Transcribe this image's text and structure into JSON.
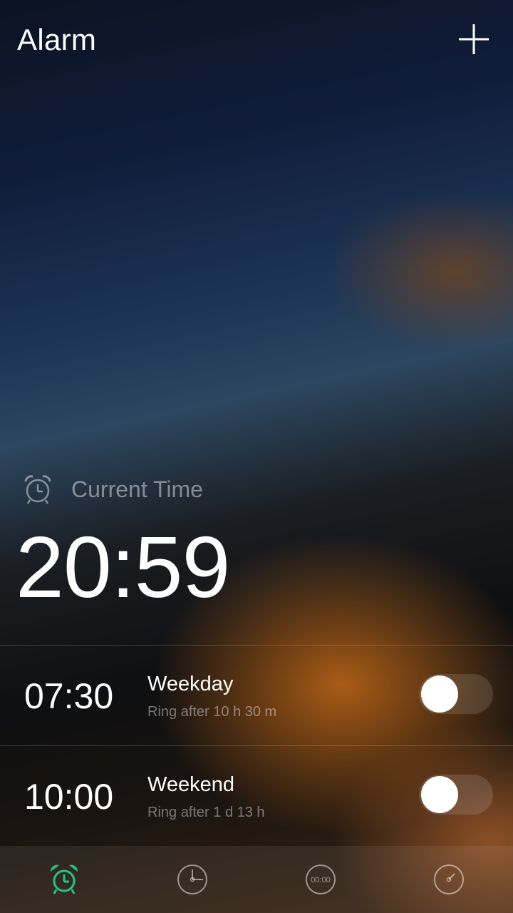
{
  "header": {
    "title": "Alarm",
    "add_icon": "plus-icon"
  },
  "current": {
    "label": "Current Time",
    "icon": "alarm-clock-icon",
    "time": "20:59"
  },
  "alarms": [
    {
      "time": "07:30",
      "name": "Weekday",
      "subtitle": "Ring after 10 h 30 m",
      "enabled": false
    },
    {
      "time": "10:00",
      "name": "Weekend",
      "subtitle": "Ring after 1 d 13 h",
      "enabled": false
    }
  ],
  "nav": {
    "tabs": [
      {
        "id": "alarm",
        "icon": "alarm-clock-icon",
        "active": true
      },
      {
        "id": "world-clock",
        "icon": "clock-icon",
        "active": false
      },
      {
        "id": "stopwatch",
        "icon": "stopwatch-icon",
        "label": "00:00",
        "active": false
      },
      {
        "id": "timer",
        "icon": "timer-icon",
        "active": false
      }
    ],
    "active_color": "#1fc77a",
    "inactive_color": "rgba(255,255,255,0.5)"
  }
}
